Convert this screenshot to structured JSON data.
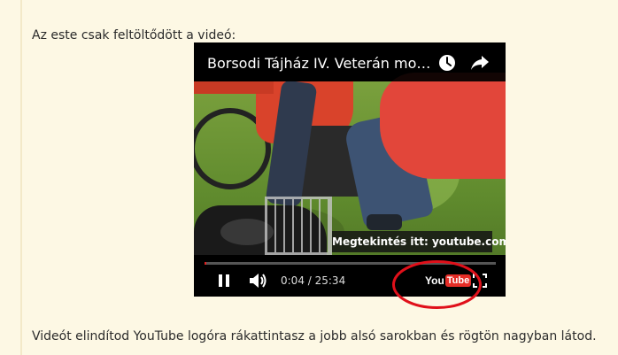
{
  "article": {
    "intro_text": "Az este csak feltöltődött a videó:",
    "instruction_text": "Videót elindítod YouTube logóra rákattintasz a jobb alsó sarokban és rögtön nagyban látod."
  },
  "player": {
    "title": "Borsodi Tájház IV. Veterán motoros",
    "watch_on_label": "Megtekintés itt: youtube.com",
    "current_time": "0:04",
    "duration": "25:34",
    "time_display": "0:04 / 25:34",
    "progress_fraction": 0.0026,
    "logo_you": "You",
    "logo_tube": "Tube",
    "colors": {
      "progress": "#e02020",
      "logo_red": "#e52d27",
      "annotation": "#e0101a"
    },
    "icons": [
      "clock-icon",
      "share-icon",
      "pause-icon",
      "volume-icon",
      "youtube-logo",
      "fullscreen-icon"
    ]
  }
}
